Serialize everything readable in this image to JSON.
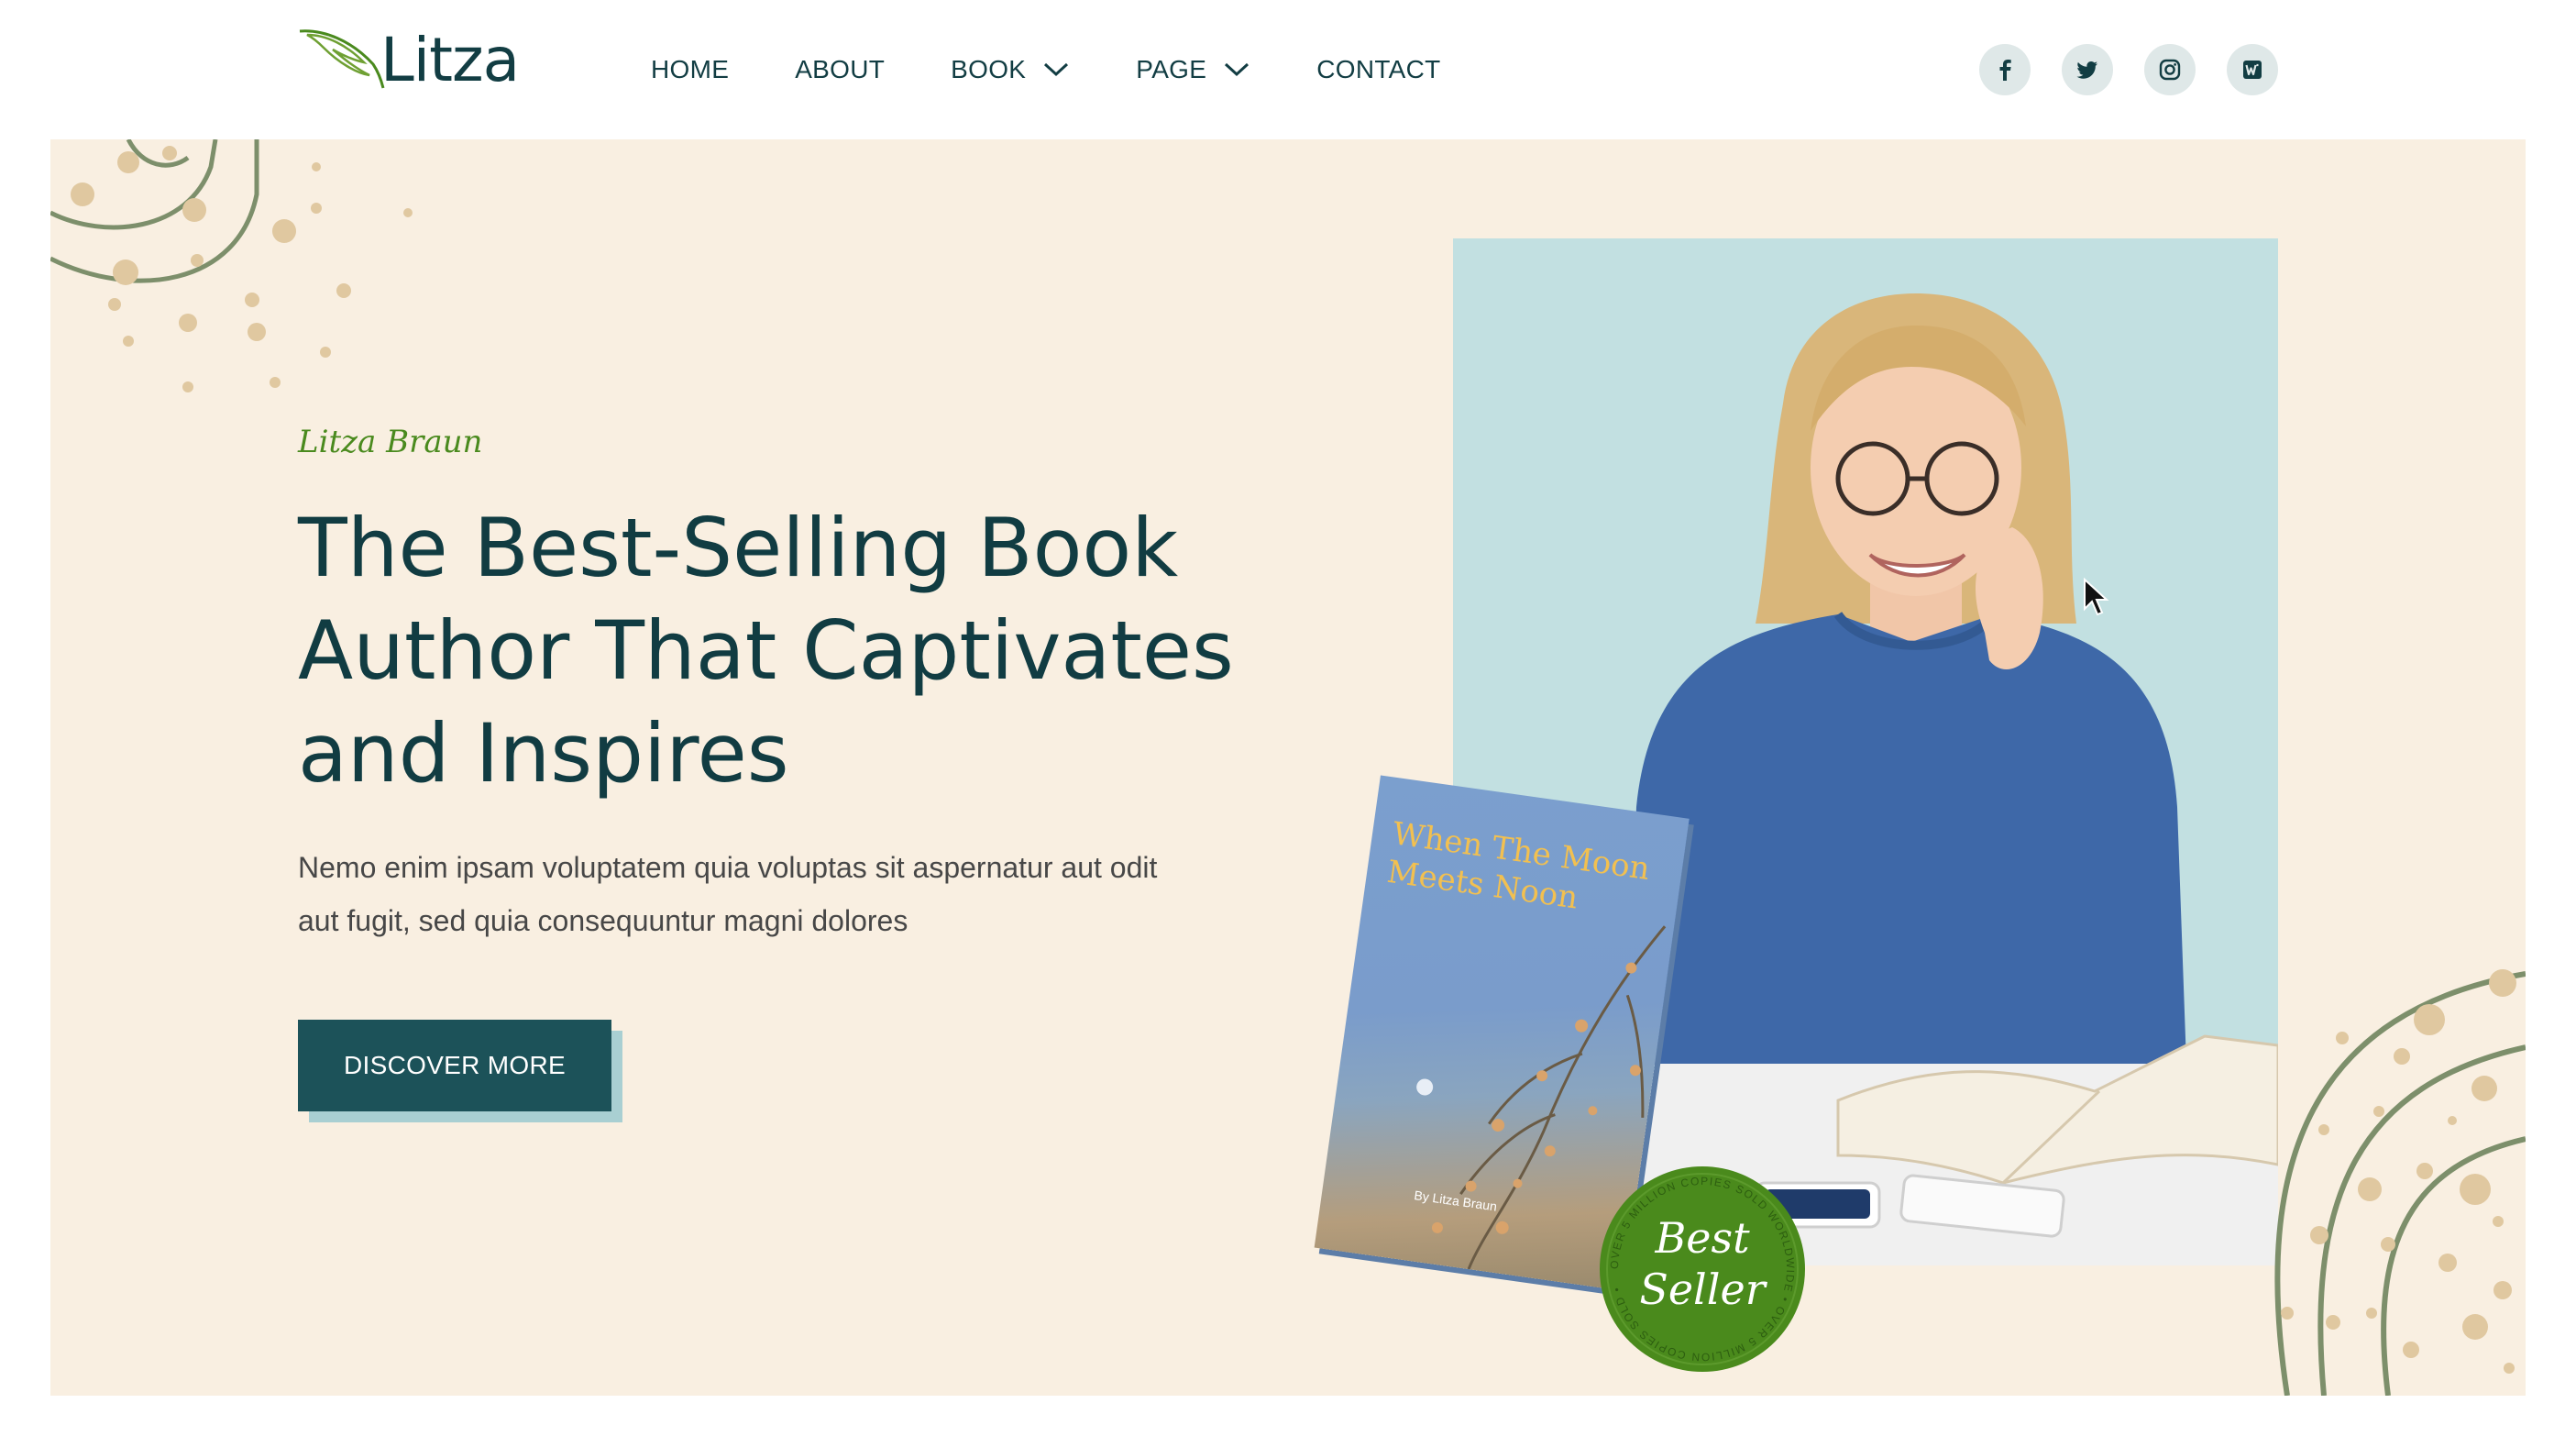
{
  "brand": {
    "name": "Litza"
  },
  "nav": {
    "items": [
      {
        "label": "HOME",
        "dropdown": false
      },
      {
        "label": "ABOUT",
        "dropdown": false
      },
      {
        "label": "BOOK",
        "dropdown": true
      },
      {
        "label": "PAGE",
        "dropdown": true
      },
      {
        "label": "CONTACT",
        "dropdown": false
      }
    ]
  },
  "socials": [
    {
      "icon": "facebook-icon"
    },
    {
      "icon": "twitter-icon"
    },
    {
      "icon": "instagram-icon"
    },
    {
      "icon": "goodreads-w-icon"
    }
  ],
  "hero": {
    "author": "Litza Braun",
    "title": "The Best-Selling Book Author That Captivates and Inspires",
    "description": "Nemo enim ipsam voluptatem quia voluptas sit aspernatur aut odit aut fugit, sed quia consequuntur magni dolores",
    "cta_label": "DISCOVER MORE"
  },
  "book": {
    "title": "When The Moon Meets Noon",
    "author": "By Litza Braun"
  },
  "badge": {
    "main": "Best Seller",
    "ring": "OVER 5 MILLION COPIES SOLD WORLDWIDE • OVER 5 MILLION COPIES SOLD •"
  },
  "colors": {
    "primary": "#1c5259",
    "accent_green": "#4a8a1c",
    "hero_bg": "#f9efe1",
    "photo_bg": "#c2e0e1",
    "heading": "#113c42"
  }
}
